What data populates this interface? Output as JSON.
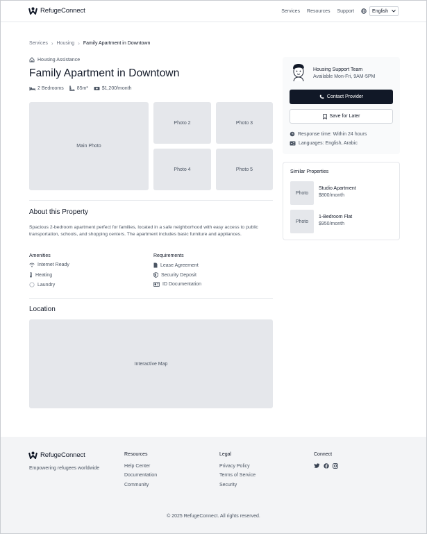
{
  "brand": {
    "name": "RefugeConnect",
    "tagline": "Empowering refugees worldwide"
  },
  "nav": {
    "items": [
      "Services",
      "Resources",
      "Support"
    ],
    "language": "English"
  },
  "breadcrumb": [
    "Services",
    "Housing",
    "Family Apartment in Downtown"
  ],
  "listing": {
    "category": "Housing Assistance",
    "title": "Family Apartment in Downtown",
    "bedrooms": "2 Bedrooms",
    "area": "85m²",
    "price": "$1,200/month"
  },
  "photos": {
    "main": "Main Photo",
    "p2": "Photo 2",
    "p3": "Photo 3",
    "p4": "Photo 4",
    "p5": "Photo 5"
  },
  "about": {
    "heading": "About this Property",
    "description": "Spacious 2-bedroom apartment perfect for families, located in a safe neighborhood with easy access to public transportation, schools, and shopping centers. The apartment includes basic furniture and appliances.",
    "amenities_title": "Amenities",
    "amenities": [
      "Internet Ready",
      "Heating",
      "Laundry"
    ],
    "requirements_title": "Requirements",
    "requirements": [
      "Lease Agreement",
      "Security Deposit",
      "ID Documentation"
    ]
  },
  "location": {
    "heading": "Location",
    "map_label": "Interactive Map"
  },
  "provider": {
    "team": "Housing Support Team",
    "hours": "Available Mon-Fri, 9AM-5PM",
    "contact_label": "Contact Provider",
    "save_label": "Save for Later",
    "response": "Response time: Within 24 hours",
    "languages": "Languages: English, Arabic"
  },
  "similar": {
    "heading": "Similar Properties",
    "items": [
      {
        "thumb": "Photo",
        "name": "Studio Apartment",
        "price": "$800/month"
      },
      {
        "thumb": "Photo",
        "name": "1-Bedroom Flat",
        "price": "$950/month"
      }
    ]
  },
  "footer": {
    "resources": {
      "title": "Resources",
      "links": [
        "Help Center",
        "Documentation",
        "Community"
      ]
    },
    "legal": {
      "title": "Legal",
      "links": [
        "Privacy Policy",
        "Terms of Service",
        "Security"
      ]
    },
    "connect": {
      "title": "Connect",
      "icons": [
        "twitter-icon",
        "facebook-icon",
        "instagram-icon"
      ]
    },
    "copyright": "© 2025 RefugeConnect. All rights reserved."
  },
  "colors": {
    "primary": "#111827",
    "muted": "#4b5563",
    "placeholder": "#e5e7eb",
    "footer_bg": "#f3f4f6"
  }
}
